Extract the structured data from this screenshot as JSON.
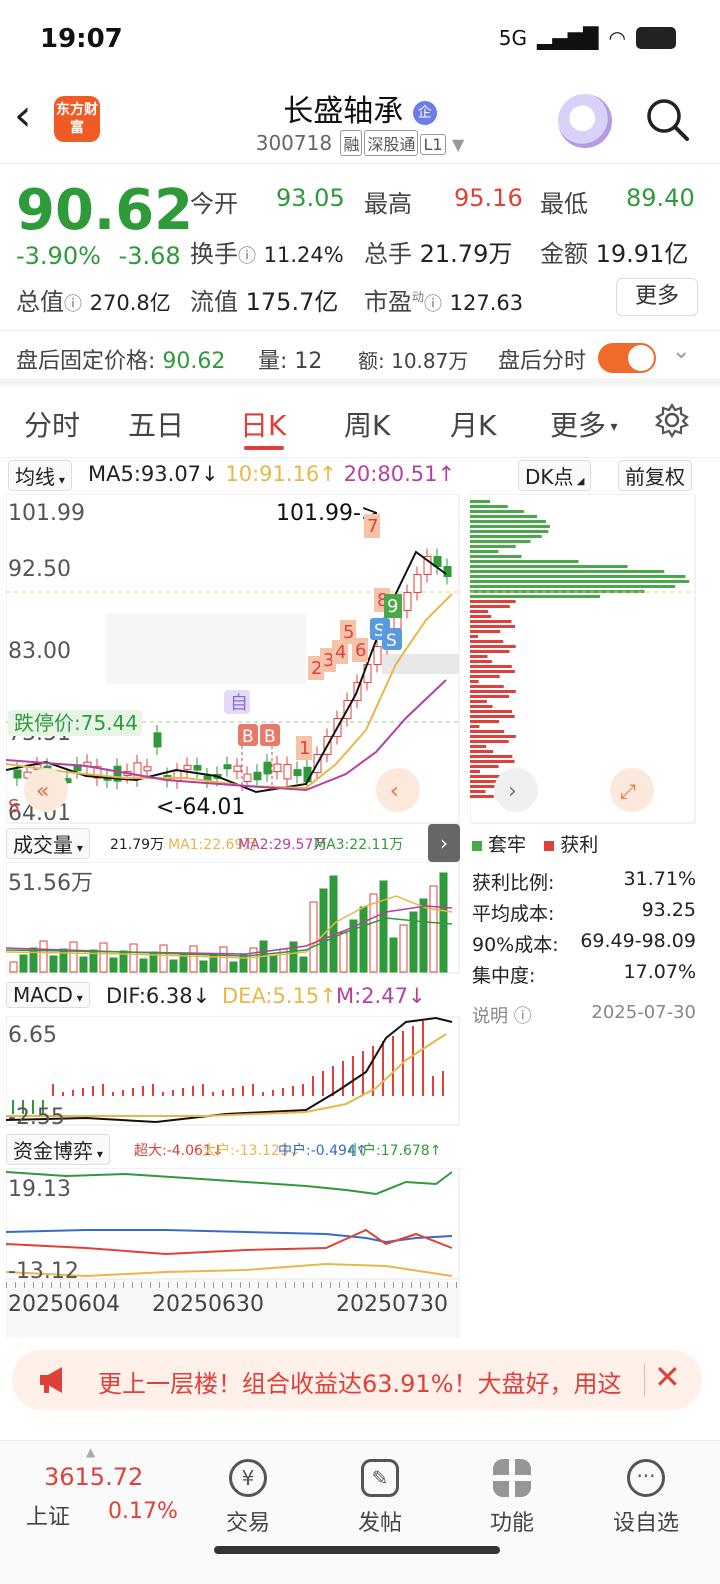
{
  "status_bar": {
    "time": "19:07",
    "network": "5G"
  },
  "header": {
    "logo_text": "东方财富",
    "title": "长盛轴承",
    "title_badge": "企",
    "code": "300718",
    "tags": [
      "融",
      "深股通",
      "L1"
    ]
  },
  "quote": {
    "price": "90.62",
    "change_pct": "-3.90%",
    "change_amt": "-3.68",
    "fields": [
      {
        "label": "今开",
        "value": "93.05",
        "color": "green"
      },
      {
        "label": "最高",
        "value": "95.16",
        "color": "red"
      },
      {
        "label": "最低",
        "value": "89.40",
        "color": "green"
      },
      {
        "label": "换手",
        "value": "11.24%",
        "color": "normal"
      },
      {
        "label": "总手",
        "value": "21.79万",
        "color": "normal"
      },
      {
        "label": "金额",
        "value": "19.91亿",
        "color": "normal"
      },
      {
        "label": "总值",
        "value": "270.8亿",
        "color": "normal"
      },
      {
        "label": "流值",
        "value": "175.7亿",
        "color": "normal"
      },
      {
        "label": "市盈",
        "value": "127.63",
        "color": "normal"
      }
    ],
    "pe_super": "动",
    "more_label": "更多"
  },
  "after_hours": {
    "price_label": "盘后固定价格:",
    "price_value": "90.62",
    "vol_label": "量:",
    "vol_value": "12",
    "amt_label": "额:",
    "amt_value": "10.87万",
    "toggle_label": "盘后分时",
    "toggle_on": true
  },
  "tabs": {
    "items": [
      "分时",
      "五日",
      "日K",
      "周K",
      "月K",
      "更多"
    ],
    "active": "日K"
  },
  "ma_bar": {
    "selector": "均线",
    "ma5": "MA5:93.07",
    "ma10": "10:91.16",
    "ma20": "20:80.51",
    "dk_button": "DK点",
    "adjust_button": "前复权"
  },
  "kline": {
    "price_labels": [
      "101.99",
      "92.50",
      "83.00",
      "73.51",
      "64.01"
    ],
    "high_marker": "101.99->",
    "low_marker": "<-64.01",
    "limit_label": "跌停价:75.44",
    "auto_label": "自",
    "buy_tags": [
      "B",
      "B"
    ],
    "sell_tags": [
      "S",
      "S"
    ],
    "count_tags": [
      "1",
      "2",
      "3",
      "4",
      "5",
      "6",
      "7",
      "8",
      "9"
    ],
    "sig_s": "S"
  },
  "volume_panel": {
    "selector": "成交量",
    "vol": "21.79万",
    "ma1": "MA1:22.69万",
    "ma2": "MA2:29.57万",
    "ma3": "MA3:22.11万",
    "max_label": "51.56万"
  },
  "macd_panel": {
    "selector": "MACD",
    "dif": "DIF:6.38",
    "dea": "DEA:5.15",
    "m": "M:2.47",
    "top_label": "6.65",
    "bottom_label": "-2.55"
  },
  "fund_panel": {
    "selector": "资金博弈",
    "super": "超大:-4.061",
    "large": "大户:-13.123",
    "mid": "中户:-0.494",
    "small": "小户:17.678",
    "top_label": "19.13",
    "bottom_label": "-13.12"
  },
  "dates": [
    "20250604",
    "20250630",
    "20250730"
  ],
  "chip": {
    "legend_trapped": "套牢",
    "legend_profit": "获利",
    "rows": [
      {
        "label": "获利比例:",
        "value": "31.71%"
      },
      {
        "label": "平均成本:",
        "value": "93.25"
      },
      {
        "label": "90%成本:",
        "value": "69.49-98.09"
      },
      {
        "label": "集中度:",
        "value": "17.07%"
      }
    ],
    "note_label": "说明",
    "date": "2025-07-30"
  },
  "banner": {
    "text": "更上一层楼！组合收益达63.91%！大盘好，用这"
  },
  "bottom_nav": {
    "index_value": "3615.72",
    "index_name": "上证",
    "index_pct": "0.17%",
    "items": [
      "交易",
      "发帖",
      "功能",
      "设自选"
    ]
  },
  "colors": {
    "up": "#e0403a",
    "down": "#2e9a3a",
    "accent": "#f26a2a",
    "ma10": "#e8b74a",
    "ma20": "#b63fa0"
  }
}
